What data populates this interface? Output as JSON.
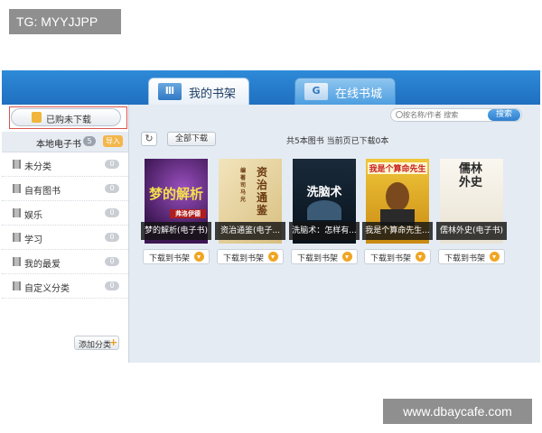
{
  "watermarks": {
    "top": "TG: MYYJJPP",
    "bottom": "www.dbaycafe.com"
  },
  "tabs": [
    {
      "label": "我的书架",
      "icon": "bookshelf-icon",
      "active": true
    },
    {
      "label": "在线书城",
      "icon": "bookstore-icon",
      "active": false
    }
  ],
  "sidebar": {
    "purchased_label": "已购未下载",
    "local": {
      "label": "本地电子书",
      "count": "5",
      "import_label": "导入"
    },
    "categories": [
      {
        "label": "未分类",
        "count": "0"
      },
      {
        "label": "自有图书",
        "count": "0"
      },
      {
        "label": "娱乐",
        "count": "0"
      },
      {
        "label": "学习",
        "count": "0"
      },
      {
        "label": "我的最爱",
        "count": "0"
      },
      {
        "label": "自定义分类",
        "count": "0"
      }
    ],
    "add_category_label": "添加分类"
  },
  "search": {
    "placeholder": "按名称/作者 搜索",
    "button_label": "搜索"
  },
  "toolbar": {
    "download_all_label": "全部下载",
    "status": "共5本图书 当前页已下载0本"
  },
  "books": [
    {
      "title": "梦的解析(电子书)",
      "cover_text": "梦的解析",
      "cover_author": "弗洛伊德",
      "download_label": "下载到书架",
      "colors": {
        "bg": "#5b2a78",
        "fg": "#f4e04d"
      }
    },
    {
      "title": "资治通鉴(电子...",
      "cover_text": "资治通鉴",
      "cover_author": "编著 司马光",
      "download_label": "下载到书架",
      "colors": {
        "bg": "#ead8a8",
        "fg": "#6b3a12"
      }
    },
    {
      "title": "洗脑术：怎样有...",
      "cover_text": "洗脑术",
      "cover_author": "",
      "download_label": "下载到书架",
      "colors": {
        "bg": "#0f2030",
        "fg": "#ffffff"
      }
    },
    {
      "title": "我是个算命先生...",
      "cover_text": "我是个算命先生",
      "cover_author": "",
      "download_label": "下载到书架",
      "colors": {
        "bg": "#d9a21a",
        "fg": "#c61d1d"
      }
    },
    {
      "title": "儒林外史(电子书)",
      "cover_text": "儒林外史",
      "cover_author": "",
      "download_label": "下载到书架",
      "colors": {
        "bg": "#f3efe6",
        "fg": "#2a2a2a"
      }
    }
  ]
}
